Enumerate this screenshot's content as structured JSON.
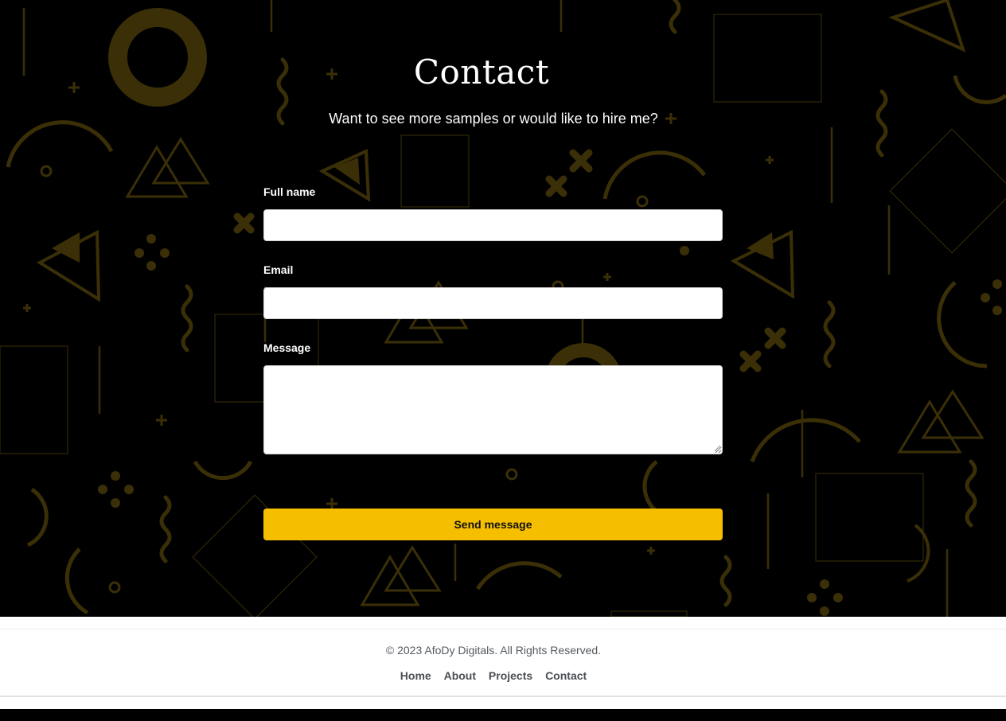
{
  "contact": {
    "title": "Contact",
    "subtitle": "Want to see more samples or would like to hire me?",
    "fullname_label": "Full name",
    "fullname_value": "",
    "email_label": "Email",
    "email_value": "",
    "message_label": "Message",
    "message_value": "",
    "send_label": "Send message"
  },
  "colors": {
    "background": "#000000",
    "pattern": "#3a2f06",
    "accent": "#f5bf00"
  },
  "footer": {
    "copyright": "© 2023 AfoDy Digitals. All Rights Reserved.",
    "nav": [
      "Home",
      "About",
      "Projects",
      "Contact"
    ]
  }
}
